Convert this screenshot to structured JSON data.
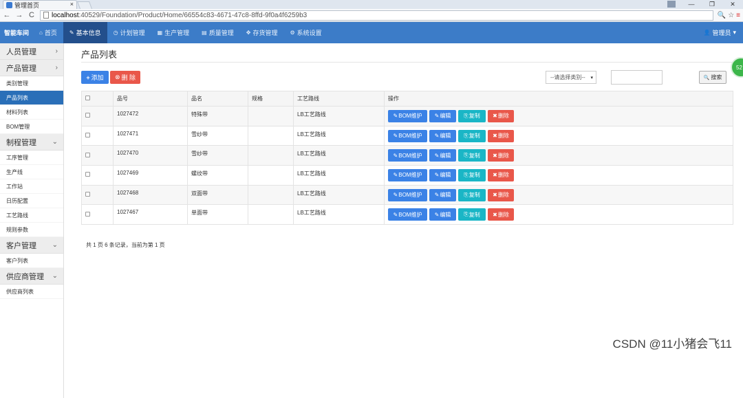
{
  "browser": {
    "tab_title": "管理首页",
    "tab_close": "×",
    "url_host": "localhost",
    "url_path": ":40529/Foundation/Product/Home/66554c83-4671-47c8-8ffd-9f0a4f6259b3",
    "back": "←",
    "forward": "→",
    "reload": "C",
    "win_min": "—",
    "win_max": "❐",
    "win_close": "✕",
    "zoom_icon": "🔍",
    "star_icon": "☆",
    "menu_icon": "≡"
  },
  "navbar": {
    "brand": "智能车间",
    "items": [
      {
        "label": "首页",
        "icon": "home-icon",
        "glyph": "⌂"
      },
      {
        "label": "基本信息",
        "icon": "wrench-icon",
        "glyph": "✎"
      },
      {
        "label": "计划管理",
        "icon": "clock-icon",
        "glyph": "◷"
      },
      {
        "label": "生产管理",
        "icon": "film-icon",
        "glyph": "▦"
      },
      {
        "label": "质量管理",
        "icon": "list-icon",
        "glyph": "▤"
      },
      {
        "label": "存货管理",
        "icon": "cubes-icon",
        "glyph": "✥"
      },
      {
        "label": "系统设置",
        "icon": "cogs-icon",
        "glyph": "⚙"
      }
    ],
    "user": "管理员",
    "user_glyph": "👤",
    "caret": "▾"
  },
  "sidebar": {
    "groups": [
      {
        "label": "人员管理",
        "chev": "›",
        "items": []
      },
      {
        "label": "产品管理",
        "chev": "›",
        "items": [
          "类别管理",
          "产品列表",
          "材料列表",
          "BOM管理"
        ]
      },
      {
        "label": "制程管理",
        "chev": "⌄",
        "items": [
          "工序管理",
          "生产线",
          "工作站",
          "日历配置",
          "工艺路线",
          "规则参数"
        ]
      },
      {
        "label": "客户管理",
        "chev": "⌄",
        "items": [
          "客户列表"
        ]
      },
      {
        "label": "供应商管理",
        "chev": "⌄",
        "items": [
          "供应商列表"
        ]
      }
    ],
    "active_item": "产品列表"
  },
  "main": {
    "title": "产品列表",
    "add_label": "添加",
    "add_glyph": "+",
    "delete_label": "删 除",
    "delete_glyph": "⊗",
    "category_select": "--请选择类别--",
    "select_caret": "▾",
    "search_label": "搜索",
    "search_glyph": "🔍",
    "badge": "52"
  },
  "table": {
    "headers": [
      "",
      "品号",
      "品名",
      "规格",
      "工艺路线",
      "操作"
    ],
    "rows": [
      {
        "code": "1027472",
        "name": "特殊带",
        "spec": "",
        "route": "LB工艺路线"
      },
      {
        "code": "1027471",
        "name": "雪纱带",
        "spec": "",
        "route": "LB工艺路线"
      },
      {
        "code": "1027470",
        "name": "雪纱带",
        "spec": "",
        "route": "LB工艺路线"
      },
      {
        "code": "1027469",
        "name": "螺纹带",
        "spec": "",
        "route": "LB工艺路线"
      },
      {
        "code": "1027468",
        "name": "双面带",
        "spec": "",
        "route": "LB工艺路线"
      },
      {
        "code": "1027467",
        "name": "单面带",
        "spec": "",
        "route": "LB工艺路线"
      }
    ],
    "op_bom": "BOM维护",
    "op_edit": "编辑",
    "op_copy": "复制",
    "op_delete": "删除",
    "op_bom_glyph": "✎",
    "op_edit_glyph": "✎",
    "op_copy_glyph": "⎘",
    "op_delete_glyph": "✖"
  },
  "pager": {
    "text": "共 1 页 6 条记录，当前为第 1 页"
  },
  "watermark": "CSDN @11小猪会飞11",
  "colors": {
    "navbar": "#3c7cc8",
    "nav_active": "#234f8c",
    "primary": "#3b82e6",
    "danger": "#e9574a",
    "info": "#1ab6c6",
    "sidebar_active": "#2a6fb8"
  }
}
